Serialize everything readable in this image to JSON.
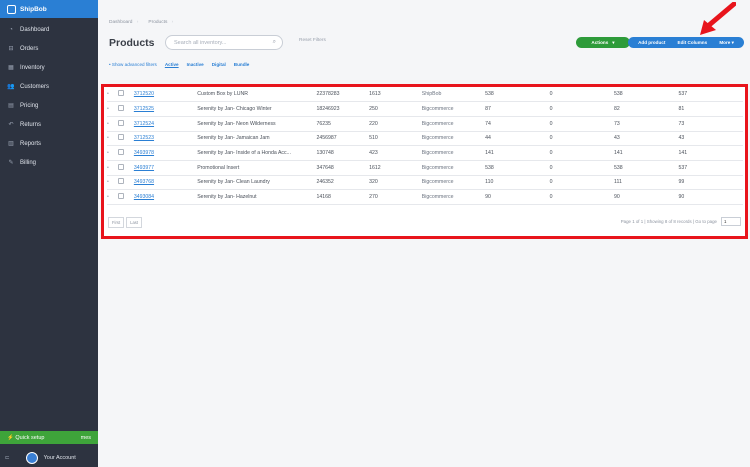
{
  "brand": {
    "name": "ShipBob"
  },
  "sidebar": {
    "items": [
      {
        "label": "Dashboard",
        "icon": "gauge-icon",
        "glyph": "◔"
      },
      {
        "label": "Orders",
        "icon": "cart-icon",
        "glyph": "⊟"
      },
      {
        "label": "Inventory",
        "icon": "box-icon",
        "glyph": "▦"
      },
      {
        "label": "Customers",
        "icon": "users-icon",
        "glyph": "👥"
      },
      {
        "label": "Pricing",
        "icon": "tag-icon",
        "glyph": "▤"
      },
      {
        "label": "Returns",
        "icon": "return-icon",
        "glyph": "↶"
      },
      {
        "label": "Reports",
        "icon": "chart-icon",
        "glyph": "▥"
      },
      {
        "label": "Billing",
        "icon": "billing-icon",
        "glyph": "✎"
      }
    ],
    "quick_setup": {
      "label": "Quick setup",
      "value": "mes"
    },
    "account": {
      "label": "Your Account"
    }
  },
  "breadcrumb": [
    "Dashboard",
    "Products"
  ],
  "page_title": "Products",
  "search": {
    "placeholder": "Search all inventory..."
  },
  "reset_filters": "Reset Filters",
  "actions_button": "Actions",
  "add_product": "Add product",
  "edit_columns": "Edit Columns",
  "more": "More",
  "filters": {
    "advanced": "• Show advanced filters",
    "tabs": [
      "Active",
      "Inactive",
      "Digital",
      "Bundle"
    ]
  },
  "rows": [
    {
      "sku": "3712520",
      "name": "Custom Box by LUNR",
      "barcode": "22378283",
      "size": "1613",
      "channel": "ShipBob",
      "n1": "538",
      "n2": "0",
      "n3": "538",
      "n4": "537"
    },
    {
      "sku": "3712525",
      "name": "Serenity by Jan- Chicago Winter",
      "barcode": "18246923",
      "size": "250",
      "channel": "Bigcommerce",
      "n1": "87",
      "n2": "0",
      "n3": "82",
      "n4": "81"
    },
    {
      "sku": "3712524",
      "name": "Serenity by Jan- Neon Wilderness",
      "barcode": "76235",
      "size": "220",
      "channel": "Bigcommerce",
      "n1": "74",
      "n2": "0",
      "n3": "73",
      "n4": "73"
    },
    {
      "sku": "3712523",
      "name": "Serenity by Jan- Jamaican Jam",
      "barcode": "2456987",
      "size": "510",
      "channel": "Bigcommerce",
      "n1": "44",
      "n2": "0",
      "n3": "43",
      "n4": "43"
    },
    {
      "sku": "3493978",
      "name": "Serenity by Jan- Inside of a Honda Acc...",
      "barcode": "130748",
      "size": "423",
      "channel": "Bigcommerce",
      "n1": "141",
      "n2": "0",
      "n3": "141",
      "n4": "141"
    },
    {
      "sku": "3493977",
      "name": "Promotional Insert",
      "barcode": "347648",
      "size": "1612",
      "channel": "Bigcommerce",
      "n1": "538",
      "n2": "0",
      "n3": "538",
      "n4": "537"
    },
    {
      "sku": "3493768",
      "name": "Serenity by Jan- Clean Laundry",
      "barcode": "246352",
      "size": "320",
      "channel": "Bigcommerce",
      "n1": "110",
      "n2": "0",
      "n3": "111",
      "n4": "99"
    },
    {
      "sku": "3493084",
      "name": "Serenity by Jan- Hazelnut",
      "barcode": "14168",
      "size": "270",
      "channel": "Bigcommerce",
      "n1": "90",
      "n2": "0",
      "n3": "90",
      "n4": "90"
    }
  ],
  "pager": {
    "first": "First",
    "last": "Last",
    "info": "Page 1 of 1  |  Showing 8 of 8 records  |  Go to page",
    "page": "1"
  },
  "colors": {
    "sidebar": "#2d3340",
    "brand": "#2a7fd4",
    "actions": "#2e9b3a",
    "highlight": "#e8141c"
  }
}
